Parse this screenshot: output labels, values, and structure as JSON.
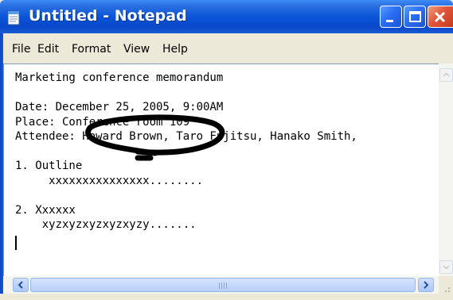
{
  "window": {
    "title": "Untitled - Notepad"
  },
  "menu": {
    "file": "File",
    "edit": "Edit",
    "format": "Format",
    "view": "View",
    "help": "Help"
  },
  "document": {
    "text": "Marketing conference memorandum\n\nDate: December 25, 2005, 9:00AM\nPlace: Conference room 109\nAttendee: Howard Brown, Taro Fujitsu, Hanako Smith,\n\n1. Outline\n     xxxxxxxxxxxxxxx........\n\n2. Xxxxxx\n    xyzxyzxyzxyzxyzy.......\n"
  },
  "colors": {
    "titlebar": "#0a55d8",
    "scribble": "#000000"
  }
}
